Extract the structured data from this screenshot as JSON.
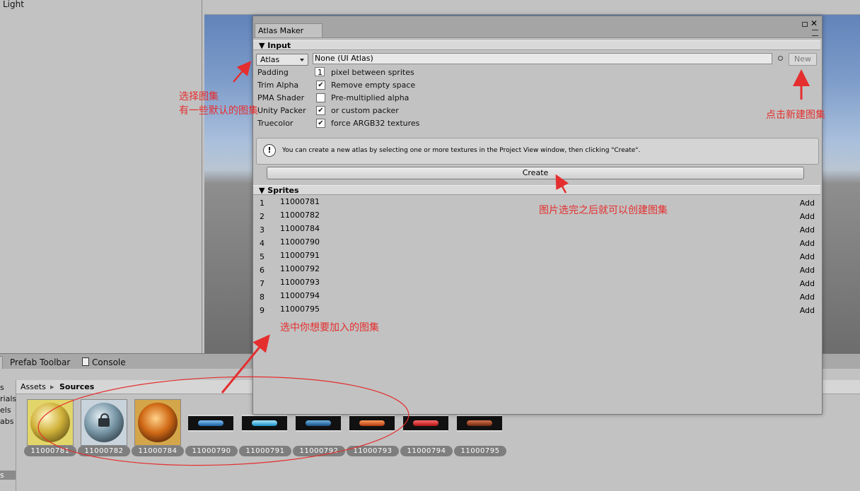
{
  "hierarchy": {
    "item": "Light"
  },
  "bottom_tabs": {
    "prefab_toolbar": "Prefab Toolbar",
    "console": "Console"
  },
  "project": {
    "tree_items": [
      "s",
      "rials",
      "els",
      "abs",
      "s"
    ],
    "breadcrumb": {
      "root": "Assets",
      "sep": "▸",
      "current": "Sources"
    },
    "assets": [
      "11000781",
      "11000782",
      "11000784",
      "11000790",
      "11000791",
      "11000792",
      "11000793",
      "11000794",
      "11000795"
    ]
  },
  "atlas_maker": {
    "tab": "Atlas Maker",
    "input": {
      "header": "▼  Input",
      "atlas_dropdown": "Atlas",
      "atlas_value": "None (UI Atlas)",
      "new_button": "New",
      "padding_label": "Padding",
      "padding_value": "1",
      "padding_text": "pixel between sprites",
      "trim_label": "Trim Alpha",
      "trim_text": "Remove empty space",
      "pma_label": "PMA Shader",
      "pma_text": "Pre-multiplied alpha",
      "unity_label": "Unity Packer",
      "unity_text": "or custom packer",
      "truecolor_label": "Truecolor",
      "truecolor_text": "force ARGB32 textures",
      "help": "You can create a new atlas by selecting one or more textures in the Project View window, then clicking \"Create\".",
      "create_button": "Create"
    },
    "sprites": {
      "header": "▼  Sprites",
      "add_label": "Add",
      "rows": [
        {
          "n": "1",
          "name": "11000781"
        },
        {
          "n": "2",
          "name": "11000782"
        },
        {
          "n": "3",
          "name": "11000784"
        },
        {
          "n": "4",
          "name": "11000790"
        },
        {
          "n": "5",
          "name": "11000791"
        },
        {
          "n": "6",
          "name": "11000792"
        },
        {
          "n": "7",
          "name": "11000793"
        },
        {
          "n": "8",
          "name": "11000794"
        },
        {
          "n": "9",
          "name": "11000795"
        }
      ]
    }
  },
  "annotations": {
    "select_atlas_1": "选择图集",
    "select_atlas_2": "有一些默认的图集",
    "new_atlas": "点击新建图集",
    "create_after": "图片选完之后就可以创建图集",
    "select_images": "选中你想要加入的图集"
  },
  "colors": {
    "annotation": "#e52e2e",
    "label_bg": "#7e7e7e"
  }
}
